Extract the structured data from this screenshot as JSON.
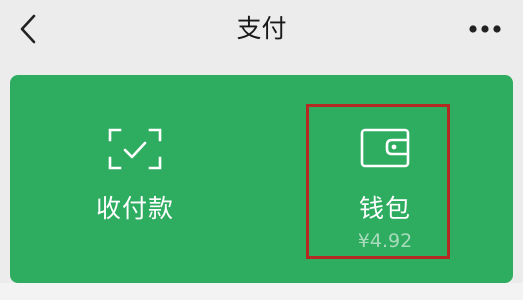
{
  "header": {
    "title": "支付",
    "back_icon": "chevron-left-icon",
    "more_icon": "more-horizontal-icon"
  },
  "card": {
    "color": "#2eac5f",
    "tiles": [
      {
        "label": "收付款",
        "icon": "scan-check-icon"
      },
      {
        "label": "钱包",
        "icon": "wallet-icon",
        "balance": "¥4.92"
      }
    ]
  },
  "highlight_color": "#b22a22"
}
